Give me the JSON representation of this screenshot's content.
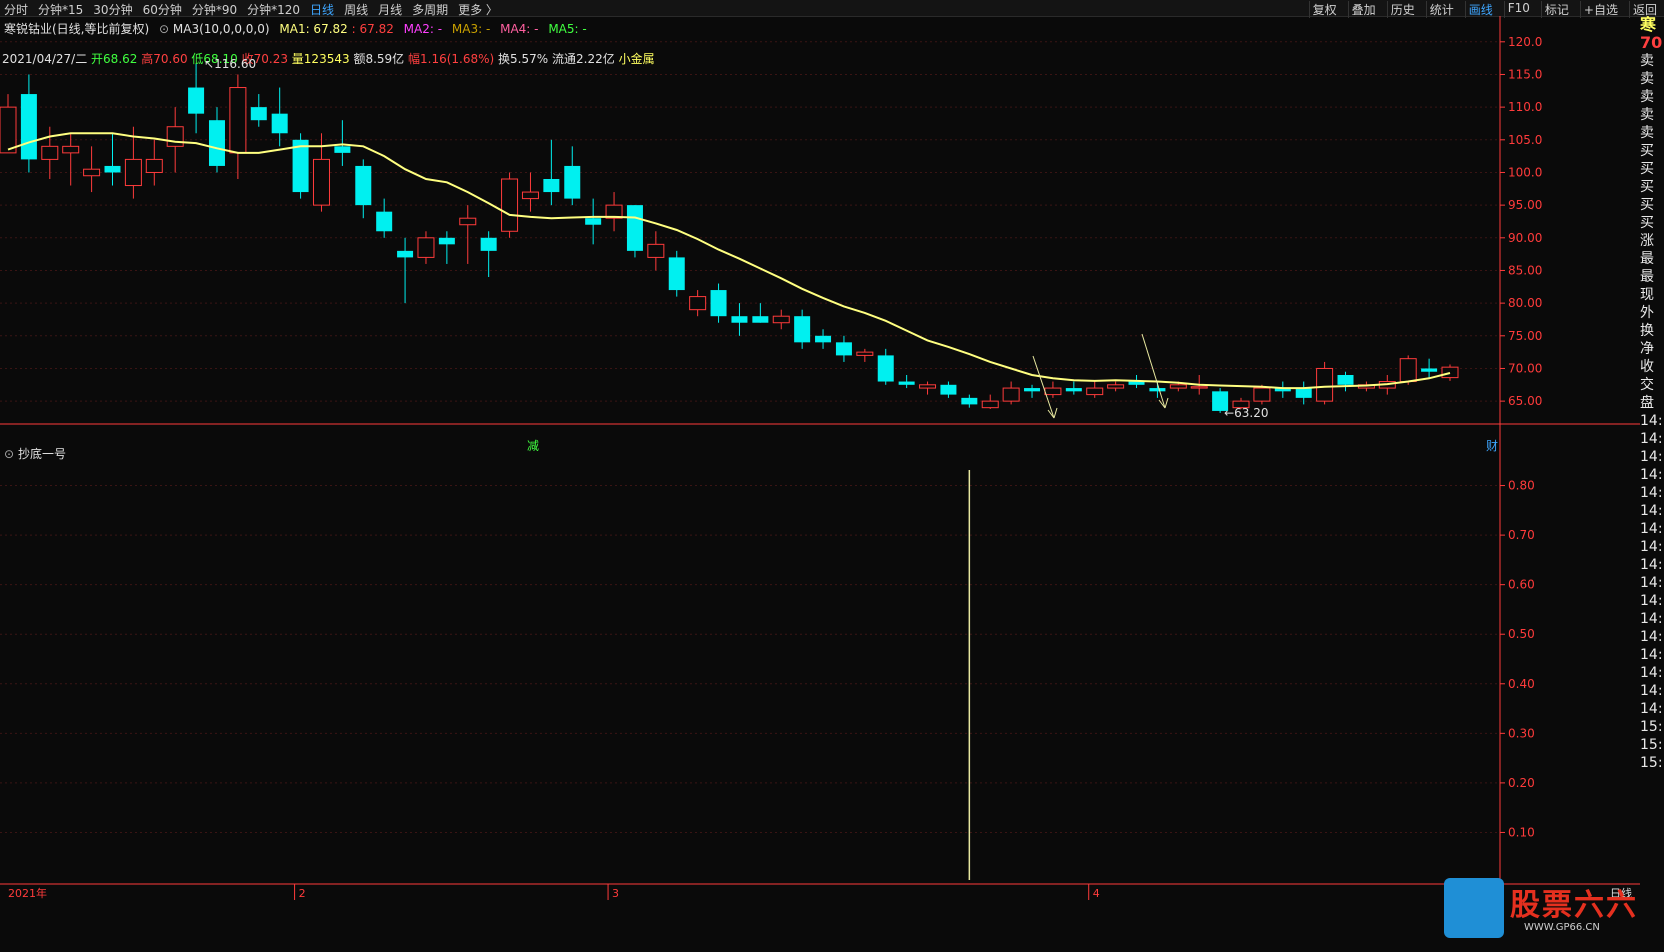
{
  "periods": [
    "分时",
    "分钟*15",
    "30分钟",
    "60分钟",
    "分钟*90",
    "分钟*120",
    "日线",
    "周线",
    "月线",
    "多周期",
    "更多 〉"
  ],
  "active_period": "日线",
  "tools": [
    "复权",
    "叠加",
    "历史",
    "统计",
    "画线",
    "F10",
    "标记",
    "+自选",
    "返回"
  ],
  "active_tool": "画线",
  "ma_line": {
    "stock": "寒锐钴业(日线,等比前复权)",
    "ma3": "MA3(10,0,0,0,0)",
    "ma1": "MA1: 67.82",
    "ma1b": ": 67.82",
    "ma2": "MA2: -",
    "ma3b": "MA3: -",
    "ma4": "MA4: -",
    "ma5": "MA5: -"
  },
  "quote": {
    "date": "2021/04/27/二",
    "open": "开68.62",
    "high": "高70.60",
    "low": "低68.10",
    "close": "收70.23",
    "vol": "量123543",
    "amt": "额8.59亿",
    "chg": "幅1.16(1.68%)",
    "turn": "换5.57%",
    "float": "流通2.22亿",
    "tag": "小金属"
  },
  "indicator_title": "抄底一号",
  "side_labels": [
    "寒",
    "70",
    "卖",
    "卖",
    "卖",
    "卖",
    "卖",
    "买",
    "买",
    "买",
    "买",
    "买",
    "涨",
    "最",
    "最",
    "现",
    "外",
    "换",
    "净",
    "收",
    "交",
    "盘",
    "14:",
    "14:",
    "14:",
    "14:",
    "14:",
    "14:",
    "14:",
    "14:",
    "14:",
    "14:",
    "14:",
    "14:",
    "14:",
    "14:",
    "14:",
    "14:",
    "14:",
    "15:",
    "15:",
    "15:"
  ],
  "logo": {
    "title": "股票六六",
    "site": "WWW.GP66.CN"
  },
  "colors": {
    "up": "#ff3b3b",
    "down": "#00f0f0",
    "ma": "#ffff80",
    "ma_red": "#ff2020",
    "axis": "#ff3b3b",
    "grid": "#3a1414",
    "yellow": "#e8e8a0"
  },
  "chart_data": {
    "type": "candlestick",
    "y_ticks": [
      "120.0",
      "115.0",
      "110.0",
      "105.0",
      "100.0",
      "95.00",
      "90.00",
      "85.00",
      "80.00",
      "75.00",
      "70.00",
      "65.00"
    ],
    "y_min": 61.5,
    "y_max": 121.5,
    "candles": [
      {
        "o": 103,
        "c": 110,
        "h": 112,
        "l": 103
      },
      {
        "o": 112,
        "c": 102,
        "h": 115,
        "l": 100
      },
      {
        "o": 102,
        "c": 104,
        "h": 107,
        "l": 99
      },
      {
        "o": 103,
        "c": 104,
        "h": 106,
        "l": 98
      },
      {
        "o": 99.5,
        "c": 100.5,
        "h": 104,
        "l": 97
      },
      {
        "o": 101,
        "c": 100,
        "h": 106,
        "l": 98
      },
      {
        "o": 98,
        "c": 102,
        "h": 107,
        "l": 96
      },
      {
        "o": 100,
        "c": 102,
        "h": 105,
        "l": 98
      },
      {
        "o": 104,
        "c": 107,
        "h": 110,
        "l": 100
      },
      {
        "o": 113,
        "c": 109,
        "h": 116.6,
        "l": 106
      },
      {
        "o": 108,
        "c": 101,
        "h": 110,
        "l": 100
      },
      {
        "o": 103,
        "c": 113,
        "h": 115,
        "l": 99
      },
      {
        "o": 110,
        "c": 108,
        "h": 112,
        "l": 107
      },
      {
        "o": 109,
        "c": 106,
        "h": 113,
        "l": 104
      },
      {
        "o": 105,
        "c": 97,
        "h": 106,
        "l": 96
      },
      {
        "o": 95,
        "c": 102,
        "h": 106,
        "l": 94
      },
      {
        "o": 104,
        "c": 103,
        "h": 108,
        "l": 101
      },
      {
        "o": 101,
        "c": 95,
        "h": 102,
        "l": 93
      },
      {
        "o": 94,
        "c": 91,
        "h": 96,
        "l": 90
      },
      {
        "o": 88,
        "c": 87,
        "h": 90,
        "l": 80
      },
      {
        "o": 87,
        "c": 90,
        "h": 91,
        "l": 86
      },
      {
        "o": 90,
        "c": 89,
        "h": 91,
        "l": 86
      },
      {
        "o": 92,
        "c": 93,
        "h": 95,
        "l": 86
      },
      {
        "o": 90,
        "c": 88,
        "h": 91,
        "l": 84
      },
      {
        "o": 91,
        "c": 99,
        "h": 100,
        "l": 90
      },
      {
        "o": 96,
        "c": 97,
        "h": 100,
        "l": 94
      },
      {
        "o": 99,
        "c": 97,
        "h": 105,
        "l": 95
      },
      {
        "o": 101,
        "c": 96,
        "h": 104,
        "l": 95
      },
      {
        "o": 93,
        "c": 92,
        "h": 96,
        "l": 89
      },
      {
        "o": 93,
        "c": 95,
        "h": 97,
        "l": 91
      },
      {
        "o": 95,
        "c": 88,
        "h": 95,
        "l": 87
      },
      {
        "o": 87,
        "c": 89,
        "h": 91,
        "l": 85
      },
      {
        "o": 87,
        "c": 82,
        "h": 88,
        "l": 81
      },
      {
        "o": 79,
        "c": 81,
        "h": 82,
        "l": 78
      },
      {
        "o": 82,
        "c": 78,
        "h": 83,
        "l": 77
      },
      {
        "o": 78,
        "c": 77,
        "h": 80,
        "l": 75
      },
      {
        "o": 78,
        "c": 77,
        "h": 80,
        "l": 77
      },
      {
        "o": 77,
        "c": 78,
        "h": 79,
        "l": 76
      },
      {
        "o": 78,
        "c": 74,
        "h": 79,
        "l": 73
      },
      {
        "o": 75,
        "c": 74,
        "h": 76,
        "l": 73
      },
      {
        "o": 74,
        "c": 72,
        "h": 75,
        "l": 71
      },
      {
        "o": 72,
        "c": 72.5,
        "h": 73,
        "l": 71
      },
      {
        "o": 72,
        "c": 68,
        "h": 73,
        "l": 67.5
      },
      {
        "o": 68,
        "c": 67.5,
        "h": 69,
        "l": 67
      },
      {
        "o": 67,
        "c": 67.5,
        "h": 68,
        "l": 66
      },
      {
        "o": 67.5,
        "c": 66,
        "h": 68,
        "l": 65.5
      },
      {
        "o": 65.5,
        "c": 64.5,
        "h": 66,
        "l": 64
      },
      {
        "o": 64,
        "c": 65,
        "h": 66,
        "l": 63.8
      },
      {
        "o": 65,
        "c": 67,
        "h": 68,
        "l": 64.5
      },
      {
        "o": 67,
        "c": 66.5,
        "h": 67.5,
        "l": 65.5
      },
      {
        "o": 66,
        "c": 67,
        "h": 68,
        "l": 65.5
      },
      {
        "o": 67,
        "c": 66.5,
        "h": 68,
        "l": 66
      },
      {
        "o": 66,
        "c": 67,
        "h": 68,
        "l": 65.5
      },
      {
        "o": 67,
        "c": 67.5,
        "h": 68,
        "l": 66.5
      },
      {
        "o": 68,
        "c": 67.5,
        "h": 69,
        "l": 67
      },
      {
        "o": 67,
        "c": 66.5,
        "h": 68,
        "l": 65.5
      },
      {
        "o": 67,
        "c": 67.5,
        "h": 68,
        "l": 66.5
      },
      {
        "o": 67,
        "c": 67.2,
        "h": 69,
        "l": 66
      },
      {
        "o": 66.5,
        "c": 63.5,
        "h": 67,
        "l": 63.2
      },
      {
        "o": 64,
        "c": 65,
        "h": 65.5,
        "l": 63.8
      },
      {
        "o": 65,
        "c": 67,
        "h": 67.5,
        "l": 64.5
      },
      {
        "o": 67,
        "c": 66.5,
        "h": 68,
        "l": 65.5
      },
      {
        "o": 67,
        "c": 65.5,
        "h": 68,
        "l": 64.5
      },
      {
        "o": 65,
        "c": 70,
        "h": 71,
        "l": 64.5
      },
      {
        "o": 69,
        "c": 67.5,
        "h": 69.5,
        "l": 66.5
      },
      {
        "o": 67,
        "c": 67.5,
        "h": 68,
        "l": 66.5
      },
      {
        "o": 67,
        "c": 68,
        "h": 69,
        "l": 66
      },
      {
        "o": 68,
        "c": 71.5,
        "h": 72,
        "l": 67.5
      },
      {
        "o": 70,
        "c": 69.5,
        "h": 71.5,
        "l": 68.5
      },
      {
        "o": 68.6,
        "c": 70.2,
        "h": 70.6,
        "l": 68.1
      }
    ],
    "ma": [
      103.5,
      104.6,
      105.5,
      106,
      106,
      106,
      105.5,
      105.2,
      104.7,
      104.5,
      103.7,
      103,
      103,
      103.5,
      104,
      104,
      104.3,
      104,
      102.5,
      100.5,
      99,
      98.5,
      97,
      95.3,
      93.5,
      93.2,
      93,
      93.1,
      93.2,
      93.2,
      93.1,
      92.2,
      91.2,
      89.8,
      88.2,
      86.8,
      85.3,
      83.8,
      82.2,
      80.8,
      79.5,
      78.5,
      77.3,
      75.8,
      74.3,
      73.3,
      72.2,
      71,
      70,
      69,
      68.5,
      68.2,
      68.1,
      68.2,
      68.1,
      68,
      67.8,
      67.5,
      67.4,
      67.3,
      67.2,
      67,
      67,
      67.2,
      67.3,
      67.4,
      67.6,
      68,
      68.5,
      69.3
    ],
    "annotations": {
      "high": "116.60",
      "low": "63.20"
    },
    "event_marks": [
      "减",
      "财"
    ],
    "indicator_y_ticks": [
      "0.80",
      "0.70",
      "0.60",
      "0.50",
      "0.40",
      "0.30",
      "0.20",
      "0.10"
    ],
    "indicator_signal_index": 46,
    "x_labels": [
      {
        "idx": 0,
        "text": "2021年"
      },
      {
        "idx": 14,
        "text": "2"
      },
      {
        "idx": 29,
        "text": "3"
      },
      {
        "idx": 52,
        "text": "4"
      }
    ],
    "x_right_label": "日线"
  }
}
